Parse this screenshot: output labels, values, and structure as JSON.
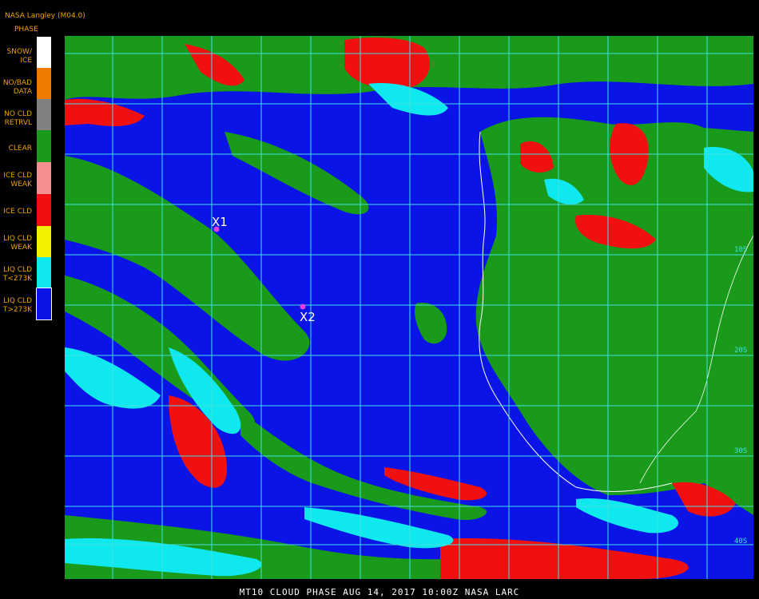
{
  "header": {
    "title": "CLOUD PHASE",
    "subtitle": "Aug 14, 2017 10:00 UTC",
    "org": "NASA Langley (M04.0)",
    "legend_title": "PHASE"
  },
  "legend": [
    {
      "label": "SNOW/\nICE",
      "color": "#ffffff"
    },
    {
      "label": "NO/BAD\nDATA",
      "color": "#f07a00"
    },
    {
      "label": "NO CLD\nRETRVL",
      "color": "#808080"
    },
    {
      "label": "CLEAR",
      "color": "#1a9a1a"
    },
    {
      "label": "ICE CLD\nWEAK",
      "color": "#f49090"
    },
    {
      "label": "ICE CLD",
      "color": "#f01010"
    },
    {
      "label": "LIQ CLD\nWEAK",
      "color": "#f5f000"
    },
    {
      "label": "LIQ CLD\nT<273K",
      "color": "#10e8f0"
    },
    {
      "label": "LIQ CLD\nT>273K",
      "color": "#0a14e6"
    }
  ],
  "markers": [
    {
      "label": "X1"
    },
    {
      "label": "X2"
    }
  ],
  "map_labels": [
    "10S",
    "20S",
    "30S",
    "40S"
  ],
  "footer": "MT10  CLOUD PHASE   AUG 14, 2017 10:00Z   NASA LARC",
  "colors": {
    "grid": "#40e0e0",
    "ocean_liquid": "#0a14e6",
    "land_clear": "#1a9a1a",
    "marker": "#e040e0"
  }
}
